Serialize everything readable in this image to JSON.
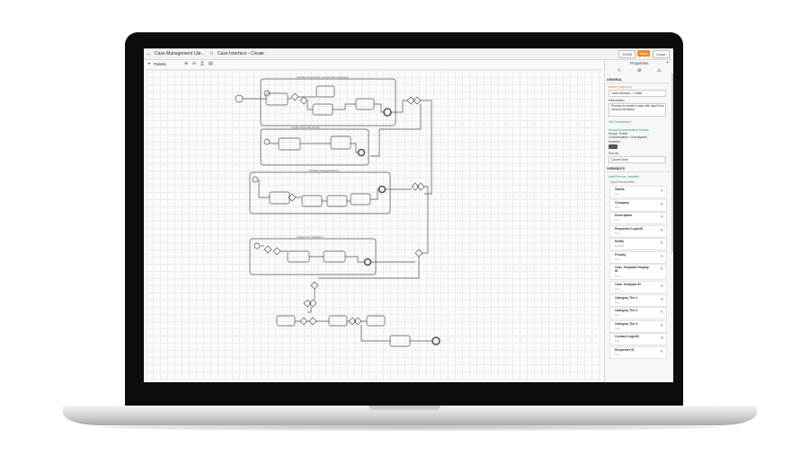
{
  "tabs": [
    {
      "label": "Case Management Libr..."
    },
    {
      "label": "Case Interface - Create"
    }
  ],
  "topbar_buttons": {
    "json": "JSON",
    "save": "Save",
    "close": "Close"
  },
  "toolbar": {
    "palette": "Palette"
  },
  "diagram_groups": [
    "Validate Requested Configuration Category",
    "Update Template Fields",
    "Validate Categorizations",
    "Assignment Validation"
  ],
  "properties": {
    "title": "Properties",
    "general_header": "GENERAL",
    "name_label": "Name (required)",
    "name_value": "Case Interface - Create",
    "description_label": "Description",
    "description_value": "Process to create a case with input from various interfaces.",
    "not_customized": "Not Customized",
    "scope_link": "Scope/Customization Details",
    "scope_text": "Scope: Public",
    "customization_text": "Customization: Overlayable",
    "enabled_label": "Enabled",
    "run_as_label": "Run as",
    "run_as_value": "Current User",
    "variables_header": "VARIABLES",
    "add_variable": "Add/Remove Variable",
    "input_parameters": "Input Parameters",
    "variables": [
      {
        "name": "Status",
        "type": "Text"
      },
      {
        "name": "Company",
        "type": "Text"
      },
      {
        "name": "Description",
        "type": "Text"
      },
      {
        "name": "Requester LoginID",
        "type": "Text"
      },
      {
        "name": "Notify",
        "type": "Boolean"
      },
      {
        "name": "Priority",
        "type": "Text"
      },
      {
        "name": "Case Template Display ID",
        "type": "Text"
      },
      {
        "name": "Case Template ID",
        "type": "Text"
      },
      {
        "name": "Category Tier 1",
        "type": "Text"
      },
      {
        "name": "Category Tier 2",
        "type": "Text"
      },
      {
        "name": "Category Tier 3",
        "type": "Text"
      },
      {
        "name": "Contact LoginID",
        "type": "Text"
      },
      {
        "name": "Requester ID",
        "type": "Text"
      }
    ]
  }
}
